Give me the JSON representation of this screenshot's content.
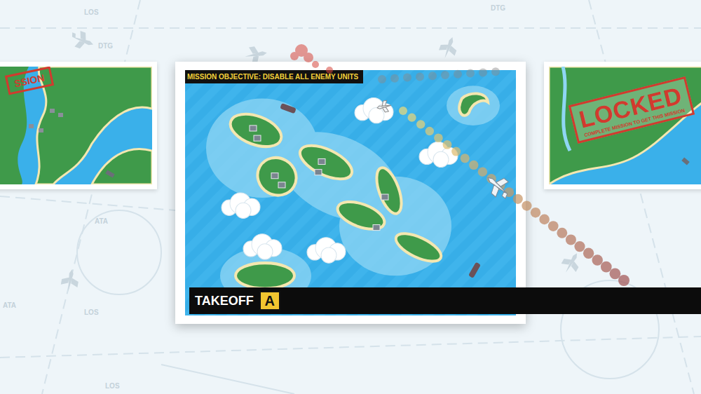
{
  "background": {
    "chart_labels": [
      "LOS",
      "DTG",
      "ATA",
      "LOS",
      "ATA",
      "DTG",
      "LOS"
    ]
  },
  "missions": [
    {
      "kind": "river",
      "selected": false,
      "locked": false,
      "stamp": "SSION",
      "stamp_note": "",
      "objective": ""
    },
    {
      "kind": "archipelago",
      "selected": true,
      "locked": false,
      "stamp": "",
      "stamp_note": "",
      "objective": "MISSION OBJECTIVE: DISABLE ALL ENEMY UNITS"
    },
    {
      "kind": "coast",
      "selected": false,
      "locked": true,
      "stamp": "LOCKED",
      "stamp_note": "COMPLETE MISSION TO GET THIS MISSION",
      "objective": ""
    }
  ],
  "action": {
    "label": "TAKEOFF",
    "key": "A"
  }
}
